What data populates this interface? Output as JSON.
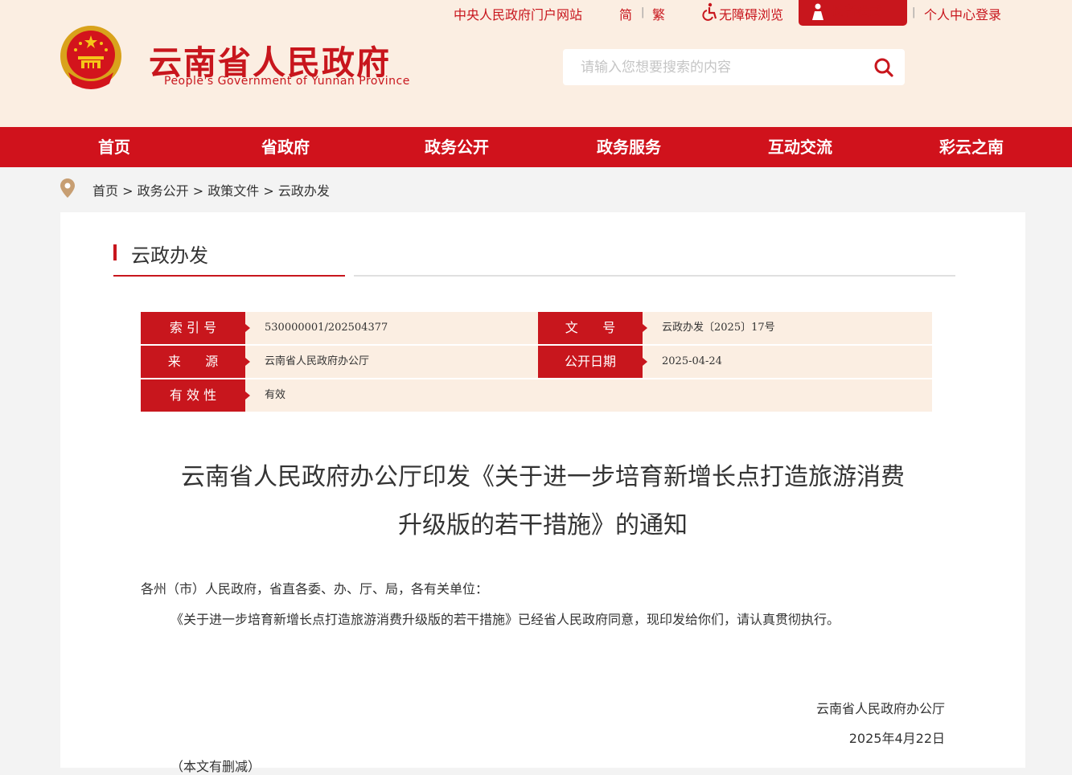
{
  "topbar": {
    "central_portal": "中央人民政府门户网站",
    "simplified": "简",
    "traditional": "繁",
    "separator": "|",
    "accessibility": "无障碍浏览",
    "elder_mode": "长者模式",
    "login": "个人中心登录"
  },
  "site": {
    "title": "云南省人民政府",
    "subtitle": "People's Government of Yunnan Province"
  },
  "search": {
    "placeholder": "请输入您想要搜索的内容",
    "value": ""
  },
  "nav": [
    "首页",
    "省政府",
    "政务公开",
    "政务服务",
    "互动交流",
    "彩云之南"
  ],
  "breadcrumb": {
    "items": [
      "首页",
      "政务公开",
      "政策文件",
      "云政办发"
    ],
    "separator": ">"
  },
  "section": {
    "title": "云政办发"
  },
  "meta": {
    "index_label": "索 引 号",
    "index_value": "530000001/202504377",
    "docno_label": "文      号",
    "docno_value": "云政办发〔2025〕17号",
    "source_label": "来      源",
    "source_value": "云南省人民政府办公厅",
    "date_label": "公开日期",
    "date_value": "2025-04-24",
    "validity_label": "有 效 性",
    "validity_value": "有效"
  },
  "document": {
    "title_line1": "云南省人民政府办公厅印发《关于进一步培育新增长点打造旅游消费",
    "title_line2": "升级版的若干措施》的通知",
    "salutation": "各州（市）人民政府，省直各委、办、厅、局，各有关单位：",
    "paragraph": "《关于进一步培育新增长点打造旅游消费升级版的若干措施》已经省人民政府同意，现印发给你们，请认真贯彻执行。",
    "signature": "云南省人民政府办公厅",
    "sign_date": "2025年4月22日",
    "note": "（本文有删减）"
  },
  "colors": {
    "brand_red": "#c8161d",
    "nav_red": "#d0121c",
    "header_bg": "#fbeee2",
    "page_bg": "#f3f3f3"
  },
  "icons": [
    "national-emblem-icon",
    "accessibility-icon",
    "elder-icon",
    "search-icon",
    "location-pin-icon"
  ]
}
